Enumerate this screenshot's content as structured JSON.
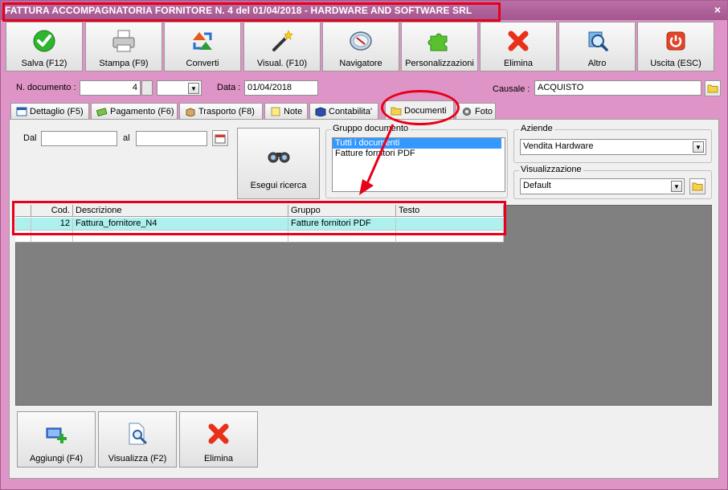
{
  "window": {
    "title": "FATTURA ACCOMPAGNATORIA FORNITORE N. 4 del 01/04/2018 - HARDWARE AND SOFTWARE SRL",
    "close": "×"
  },
  "toolbar": {
    "save": "Salva (F12)",
    "print": "Stampa (F9)",
    "convert": "Converti",
    "view": "Visual. (F10)",
    "navigator": "Navigatore",
    "customize": "Personalizzazioni",
    "delete": "Elimina",
    "other": "Altro",
    "exit": "Uscita (ESC)"
  },
  "header": {
    "doc_number_label": "N. documento :",
    "doc_number": "4",
    "date_label": "Data :",
    "date": "01/04/2018",
    "causale_label": "Causale :",
    "causale": "ACQUISTO"
  },
  "tabs": [
    {
      "label": "Dettaglio (F5)"
    },
    {
      "label": "Pagamento (F6)"
    },
    {
      "label": "Trasporto (F8)"
    },
    {
      "label": "Note"
    },
    {
      "label": "Contabilita'"
    },
    {
      "label": "Documenti"
    },
    {
      "label": "Foto"
    }
  ],
  "filters": {
    "from_label": "Dal",
    "to_label": "al",
    "search_button": "Esegui ricerca"
  },
  "group": {
    "title": "Gruppo documento",
    "items": [
      "Tutti i documenti",
      "Fatture fornitori PDF"
    ]
  },
  "aziende": {
    "title": "Aziende",
    "value": "Vendita Hardware"
  },
  "visualizzazione": {
    "title": "Visualizzazione",
    "value": "Default"
  },
  "grid": {
    "columns": [
      "Cod.",
      "Descrizione",
      "Gruppo",
      "Testo"
    ],
    "rows": [
      {
        "cod": "12",
        "descrizione": "Fattura_fornitore_N4",
        "gruppo": "Fatture fornitori PDF",
        "testo": ""
      }
    ]
  },
  "bottom": {
    "add": "Aggiungi (F4)",
    "view": "Visualizza (F2)",
    "delete": "Elimina"
  },
  "colors": {
    "window_bg": "#de94c6",
    "titlebar": "#a4578e",
    "highlight": "#e8001a",
    "row_selected": "#aef0ee"
  }
}
